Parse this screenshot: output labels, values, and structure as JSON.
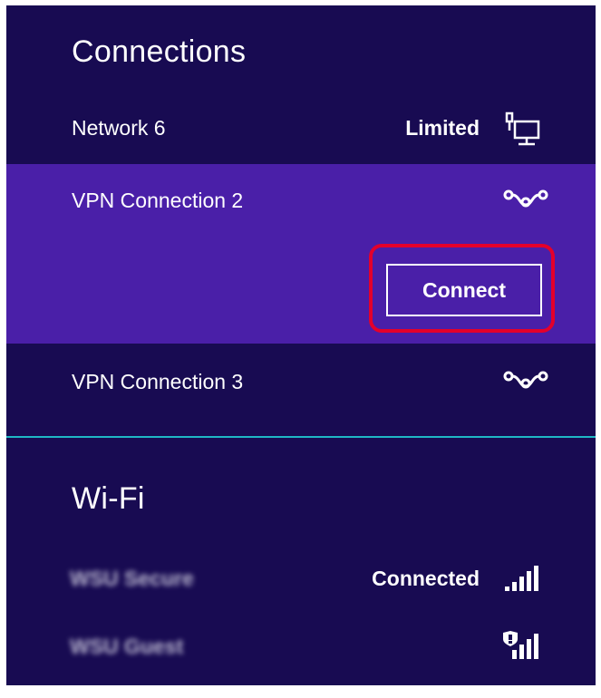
{
  "connections": {
    "title": "Connections",
    "items": [
      {
        "label": "Network  6",
        "status": "Limited",
        "icon": "wired-network-icon"
      },
      {
        "label": "VPN Connection 2",
        "icon": "vpn-icon",
        "selected": true,
        "button": "Connect"
      },
      {
        "label": "VPN Connection 3",
        "icon": "vpn-icon"
      }
    ]
  },
  "wifi": {
    "title": "Wi-Fi",
    "networks": [
      {
        "label": "WSU Secure",
        "status": "Connected",
        "icon": "wifi-signal-icon"
      },
      {
        "label": "WSU Guest",
        "icon": "wifi-signal-shield-icon"
      }
    ]
  },
  "colors": {
    "background": "#180b52",
    "selected": "#4a1fa8",
    "divider": "#1fb7c4",
    "annotation": "#e4002b",
    "text": "#ffffff"
  }
}
